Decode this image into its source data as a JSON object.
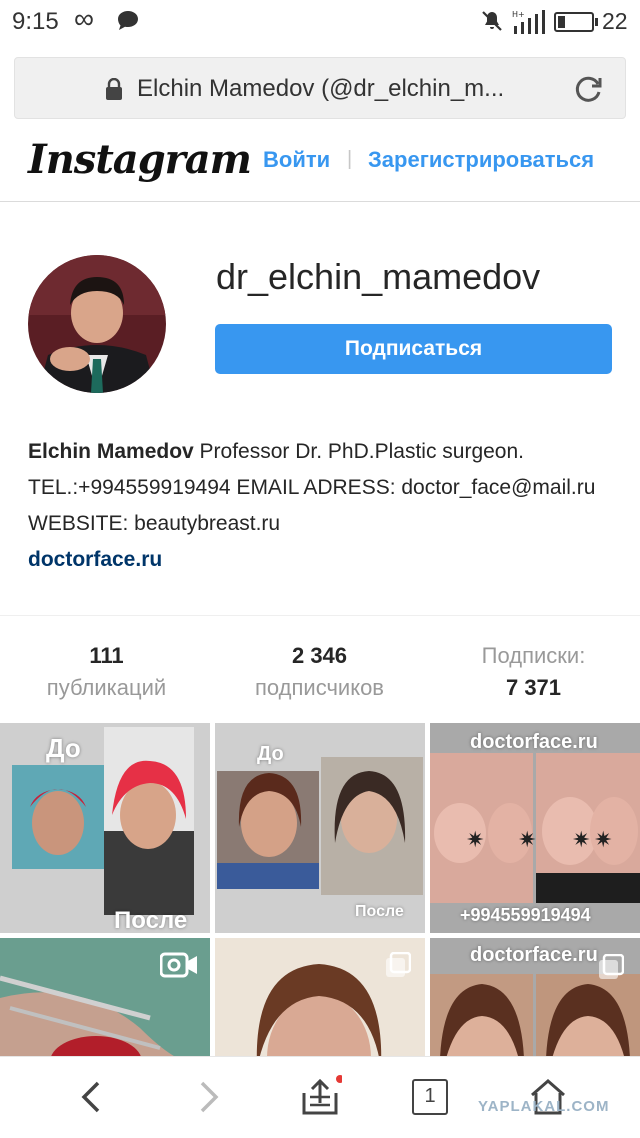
{
  "status_bar": {
    "time": "9:15",
    "loop_glyph": "∞",
    "battery_pct": "22",
    "battery_level": 0.22,
    "icons": [
      "chat-icon",
      "mute-icon",
      "signal-icon",
      "battery-icon"
    ]
  },
  "browser": {
    "url_text": "Elchin Mamedov (@dr_elchin_m...",
    "icons": [
      "lock-icon",
      "reload-icon"
    ]
  },
  "header": {
    "logo_text": "Instagram",
    "login_label": "Войти",
    "separator": "|",
    "signup_label": "Зарегистрироваться",
    "accent_color": "#3897f0"
  },
  "profile": {
    "username": "dr_elchin_mamedov",
    "follow_label": "Подписаться",
    "bio_name": "Elchin Mamedov",
    "bio_text": " Professor Dr. PhD.Plastic surgeon. TEL.:+994559919494 EMAIL ADRESS: doctor_face@mail.ru WEBSITE: beautybreast.ru",
    "bio_link": "doctorface.ru"
  },
  "stats": {
    "posts_count": "111",
    "posts_label": "публикаций",
    "followers_count": "2 346",
    "followers_label": "подписчиков",
    "following_label": "Подписки:",
    "following_count": "7 371"
  },
  "grid": {
    "t1_top": "До",
    "t1_bottom": "После",
    "t2_top": "До",
    "t2_bottom": "После",
    "t3_top": "doctorface.ru",
    "t3_bottom": "+994559919494",
    "t6_top": "doctorface.ru"
  },
  "bottom_nav": {
    "tab_count": "1",
    "icons": [
      "back-icon",
      "forward-icon",
      "share-icon",
      "tabs-icon",
      "home-icon"
    ]
  },
  "watermark": "YAPLAKAL.COM"
}
